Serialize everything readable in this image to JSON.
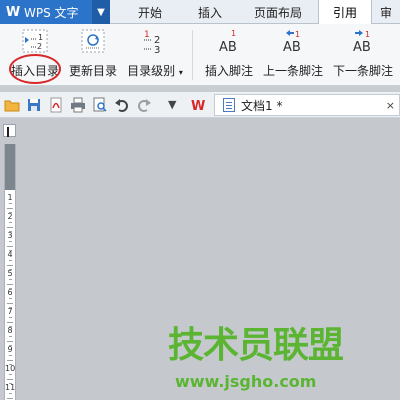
{
  "app": {
    "title": "WPS 文字",
    "logo": "W"
  },
  "tabs": [
    {
      "label": "开始"
    },
    {
      "label": "插入"
    },
    {
      "label": "页面布局"
    },
    {
      "label": "引用",
      "active": true
    },
    {
      "label": "审"
    }
  ],
  "ribbon": {
    "insert_toc": "插入目录",
    "update_toc": "更新目录",
    "toc_level": "目录级别",
    "insert_footnote": "插入脚注",
    "prev_footnote": "上一条脚注",
    "next_footnote": "下一条脚注"
  },
  "document_tab": {
    "name": "文档1 *",
    "close": "×"
  },
  "ruler_numbers": [
    "1",
    "2",
    "3",
    "4",
    "5",
    "6",
    "7",
    "8",
    "9",
    "10",
    "11"
  ],
  "watermark": {
    "text": "技术员联盟",
    "url": "www.jsgho.com"
  },
  "colors": {
    "accent": "#2b74c9",
    "highlight": "#d8282a",
    "watermark": "#5bb533"
  }
}
